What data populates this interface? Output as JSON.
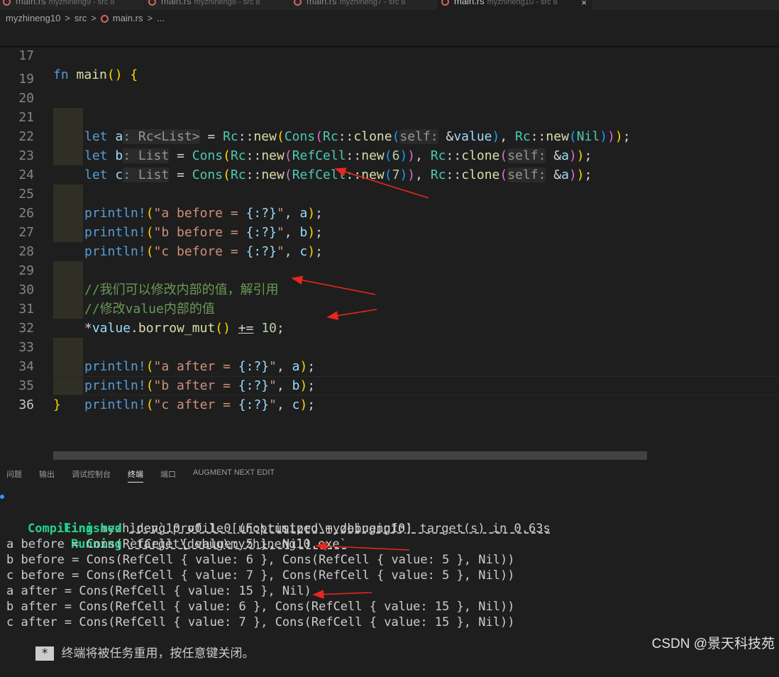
{
  "tabs": [
    {
      "name": "main.rs",
      "desc": "myzhineng9 - src 8"
    },
    {
      "name": "main.rs",
      "desc": "myzhineng8 - src 8"
    },
    {
      "name": "main.rs",
      "desc": "myzhineng7 - src 8"
    },
    {
      "name": "main.rs",
      "desc": "myzhineng10 - src 8"
    }
  ],
  "tab_close": "×",
  "breadcrumb": {
    "project": "myzhineng10",
    "sep": ">",
    "folder": "src",
    "file": "main.rs",
    "more": "..."
  },
  "lines": {
    "l17": "17",
    "l19": "19",
    "l20": "20",
    "l21": "21",
    "l22": "22",
    "l23": "23",
    "l24": "24",
    "l25": "25",
    "l26": "26",
    "l27": "27",
    "l28": "28",
    "l29": "29",
    "l30": "30",
    "l31": "31",
    "l32": "32",
    "l33": "33",
    "l34": "34",
    "l35": "35",
    "l36": "36"
  },
  "code": {
    "sticky": "fn main() {",
    "l20": "let a: Rc<List> = Rc::new(Cons(Rc::clone(self: &value), Rc::new(Nil)));",
    "l21": "let b: List = Cons(Rc::new(RefCell::new(6)), Rc::clone(self: &a));",
    "l22": "let c: List = Cons(Rc::new(RefCell::new(7)), Rc::clone(self: &a));",
    "l24": "println!(\"a before = {:?}\", a);",
    "l25": "println!(\"b before = {:?}\", b);",
    "l26": "println!(\"c before = {:?}\", c);",
    "l28": "//我们可以修改内部的值，解引用",
    "l29": "//修改value内部的值",
    "l30": "*value.borrow_mut() += 10;",
    "l32": "println!(\"a after = {:?}\", a);",
    "l33": "println!(\"b after = {:?}\", b);",
    "l34": "println!(\"c after = {:?}\", c);",
    "l35": "}"
  },
  "panel_tabs": [
    "问题",
    "输出",
    "调试控制台",
    "终端",
    "端口",
    "AUGMENT NEXT EDIT"
  ],
  "active_panel_tab": "终端",
  "terminal": {
    "compiling_label": "Compiling",
    "compiling_text": "myzhineng10 v0.1.0 (F:\\rustpro\\myzhineng10)",
    "finished_label": "Finished",
    "finished_text": "`dev` profile [unoptimized + debuginfo] target(s) in 0.63s",
    "running_label": "Running",
    "running_text": "`target\\debug\\myzhineng10.exe`",
    "out1": "a before = Cons(RefCell { value: 5 }, Nil)",
    "out2": "b before = Cons(RefCell { value: 6 }, Cons(RefCell { value: 5 }, Nil))",
    "out3": "c before = Cons(RefCell { value: 7 }, Cons(RefCell { value: 5 }, Nil))",
    "out4": "a after = Cons(RefCell { value: 15 }, Nil)",
    "out5": "b after = Cons(RefCell { value: 6 }, Cons(RefCell { value: 15 }, Nil))",
    "out6": "c after = Cons(RefCell { value: 7 }, Cons(RefCell { value: 15 }, Nil))",
    "reuse_star": "*",
    "reuse_msg": "终端将被任务重用，按任意键关闭。"
  },
  "watermark": "CSDN @景天科技苑",
  "colors": {
    "background": "#1e1e1e",
    "annotation_arrow": "#e8261e",
    "terminal_green": "#23d18b"
  }
}
